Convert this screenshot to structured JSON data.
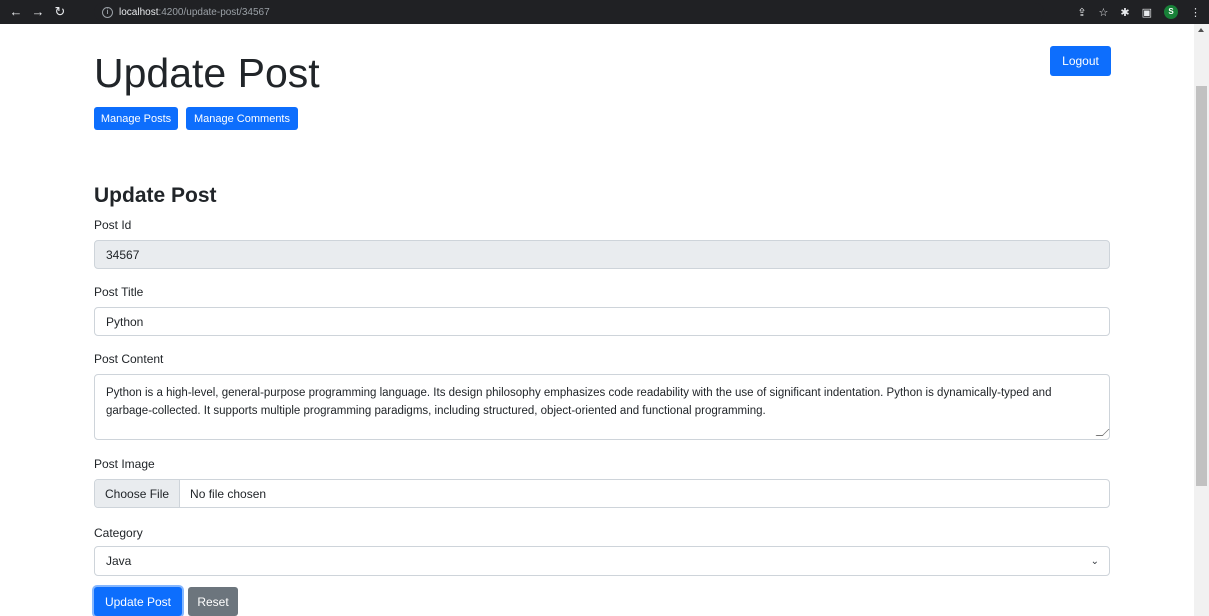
{
  "browser": {
    "url_host": "localhost",
    "url_path": ":4200/update-post/34567",
    "profile_initial": "S"
  },
  "page": {
    "title": "Update Post",
    "logout_label": "Logout",
    "nav": {
      "manage_posts": "Manage Posts",
      "manage_comments": "Manage Comments"
    }
  },
  "form": {
    "heading": "Update Post",
    "post_id": {
      "label": "Post Id",
      "value": "34567"
    },
    "post_title": {
      "label": "Post Title",
      "value": "Python"
    },
    "post_content": {
      "label": "Post Content",
      "value": "Python is a high-level, general-purpose programming language. Its design philosophy emphasizes code readability with the use of significant indentation. Python is dynamically-typed and garbage-collected. It supports multiple programming paradigms, including structured, object-oriented and functional programming."
    },
    "post_image": {
      "label": "Post Image",
      "button": "Choose File",
      "status": "No file chosen"
    },
    "category": {
      "label": "Category",
      "selected": "Java"
    },
    "submit_label": "Update Post",
    "reset_label": "Reset"
  },
  "colors": {
    "primary": "#0d6efd",
    "secondary": "#6c757d",
    "readonly_bg": "#e9ecef"
  }
}
